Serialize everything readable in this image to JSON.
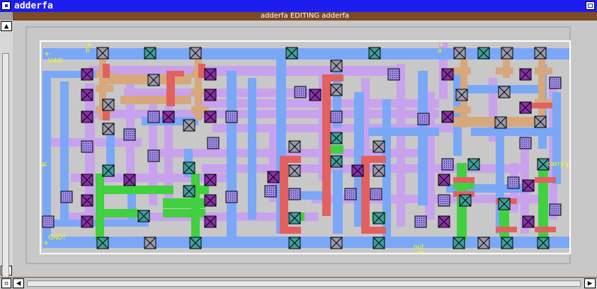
{
  "window": {
    "title": "adderfa"
  },
  "editor": {
    "status": "adderfa EDITING adderfa"
  },
  "ports": {
    "vdd": "Vdd!",
    "gnd": "GND!",
    "b": "b",
    "a": "a",
    "c": "c",
    "carry": "carry",
    "out": "out"
  },
  "colors": {
    "metal1": "#7ba7f7",
    "poly": "#e16161",
    "diffusion_n": "#40d040",
    "diffusion_p": "#d6a87c",
    "metal2": "#c8a0f0",
    "via": "#a070f0",
    "contact": "#7d2fa6",
    "titlebar": "#1d1df0",
    "label": "#ffff00"
  },
  "icons": [
    "menu-icon",
    "close-icon",
    "arrow-up-icon",
    "arrow-down-icon",
    "arrow-left-icon",
    "arrow-right-icon",
    "corner-icon"
  ]
}
